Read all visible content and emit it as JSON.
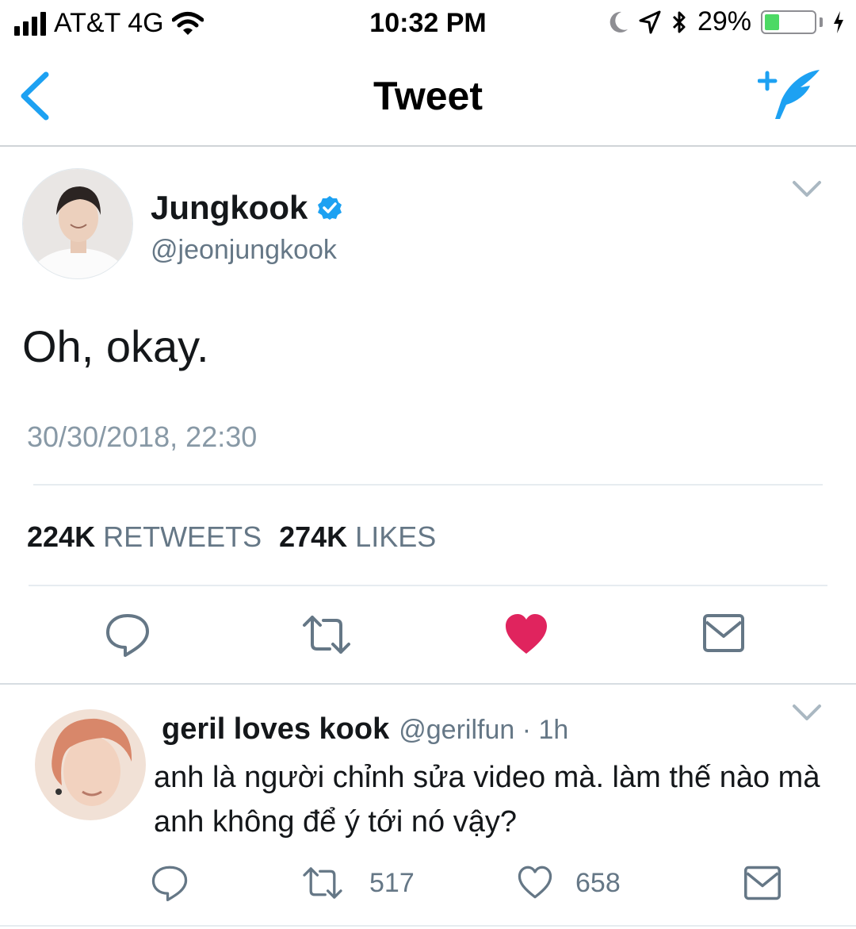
{
  "status_bar": {
    "carrier": "AT&T 4G",
    "time": "10:32 PM",
    "battery_percent": "29%",
    "battery_level": 0.29,
    "icons": [
      "signal-icon",
      "wifi-icon",
      "moon-icon",
      "location-icon",
      "bluetooth-icon",
      "battery-icon",
      "charging-icon"
    ]
  },
  "nav": {
    "title": "Tweet"
  },
  "tweet": {
    "author_name": "Jungkook",
    "author_handle": "@jeonjungkook",
    "text": "Oh, okay.",
    "timestamp": "30/30/2018, 22:30",
    "retweets_count": "224K",
    "retweets_label": "RETWEETS",
    "likes_count": "274K",
    "likes_label": "LIKES",
    "liked": true
  },
  "reply": {
    "author_name": "geril loves kook",
    "meta": "@gerilfun · 1h",
    "text": "anh là người chỉnh sửa video mà. làm thế nào mà anh không để ý tới nó vậy?",
    "retweet_count": "517",
    "like_count": "658"
  },
  "colors": {
    "twitter_blue": "#1da1f2",
    "like_red": "#e0245e",
    "muted": "#657786",
    "battery_green": "#4cd964"
  }
}
